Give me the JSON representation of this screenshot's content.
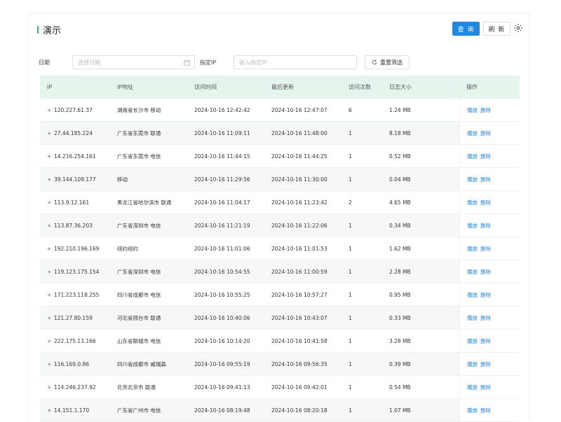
{
  "header": {
    "title": "演示",
    "query_label": "查 询",
    "refresh_label": "刷 新"
  },
  "filters": {
    "date_label": "日期",
    "date_placeholder": "选择日期",
    "ip_label": "指定IP",
    "ip_placeholder": "输入指定IP",
    "reset_label": "重置筛选"
  },
  "table": {
    "columns": [
      "IP",
      "IP地址",
      "访问时间",
      "最后更新",
      "访问次数",
      "日志大小",
      "操作"
    ],
    "action_play": "播放",
    "action_delete": "删除",
    "rows": [
      {
        "ip": "120.227.61.37",
        "location": "湖南省长沙市 移动",
        "visit": "2024-10-16 12:42:42",
        "updated": "2024-10-16 12:47:07",
        "count": "6",
        "size": "1.24 MB"
      },
      {
        "ip": "27.44.185.224",
        "location": "广东省东莞市 联通",
        "visit": "2024-10-16 11:09:11",
        "updated": "2024-10-16 11:48:00",
        "count": "1",
        "size": "8.18 MB"
      },
      {
        "ip": "14.216.254.161",
        "location": "广东省东莞市 电信",
        "visit": "2024-10-16 11:44:15",
        "updated": "2024-10-16 11:44:25",
        "count": "1",
        "size": "0.52 MB"
      },
      {
        "ip": "39.144.109.177",
        "location": "移动",
        "visit": "2024-10-16 11:29:56",
        "updated": "2024-10-16 11:30:00",
        "count": "1",
        "size": "0.04 MB"
      },
      {
        "ip": "113.9.12.161",
        "location": "黑龙江省哈尔滨市 联通",
        "visit": "2024-10-16 11:04:17",
        "updated": "2024-10-16 11:23:42",
        "count": "2",
        "size": "4.65 MB"
      },
      {
        "ip": "113.87.36.203",
        "location": "广东省深圳市 电信",
        "visit": "2024-10-16 11:21:19",
        "updated": "2024-10-16 11:22:06",
        "count": "1",
        "size": "0.34 MB"
      },
      {
        "ip": "192.210.196.169",
        "location": "纽约纽约",
        "visit": "2024-10-16 11:01:06",
        "updated": "2024-10-16 11:01:53",
        "count": "1",
        "size": "1.62 MB"
      },
      {
        "ip": "119.123.175.154",
        "location": "广东省深圳市 电信",
        "visit": "2024-10-16 10:54:55",
        "updated": "2024-10-16 11:00:59",
        "count": "1",
        "size": "2.28 MB"
      },
      {
        "ip": "171.223.118.255",
        "location": "四川省成都市 电信",
        "visit": "2024-10-16 10:55:25",
        "updated": "2024-10-16 10:57:27",
        "count": "1",
        "size": "0.95 MB"
      },
      {
        "ip": "121.27.80.159",
        "location": "河北省邢台市 联通",
        "visit": "2024-10-16 10:40:06",
        "updated": "2024-10-16 10:43:07",
        "count": "1",
        "size": "0.33 MB"
      },
      {
        "ip": "222.175.13.166",
        "location": "山东省聊城市 电信",
        "visit": "2024-10-16 10:14:20",
        "updated": "2024-10-16 10:41:58",
        "count": "1",
        "size": "3.28 MB"
      },
      {
        "ip": "116.169.0.86",
        "location": "四川省成都市 威瑞森",
        "visit": "2024-10-16 09:55:19",
        "updated": "2024-10-16 09:56:35",
        "count": "1",
        "size": "0.39 MB"
      },
      {
        "ip": "114.246.237.92",
        "location": "北京北京市 联通",
        "visit": "2024-10-16 09:41:13",
        "updated": "2024-10-16 09:42:01",
        "count": "1",
        "size": "0.54 MB"
      },
      {
        "ip": "14.151.1.170",
        "location": "广东省广州市 电信",
        "visit": "2024-10-16 08:19:48",
        "updated": "2024-10-16 08:20:18",
        "count": "1",
        "size": "1.07 MB"
      }
    ]
  }
}
